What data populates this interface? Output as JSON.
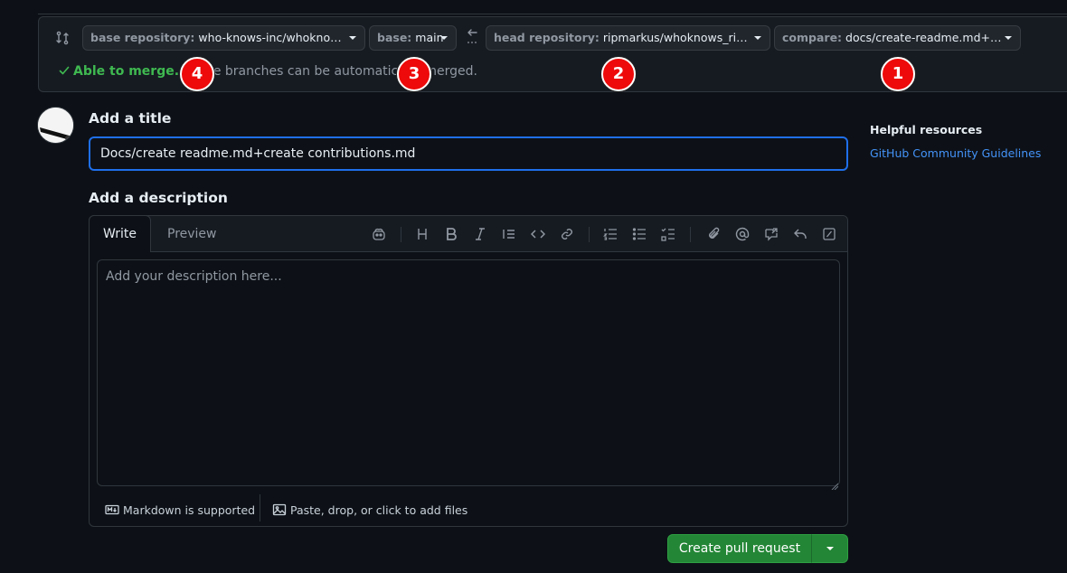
{
  "compare": {
    "base_repo_key": "base repository:",
    "base_repo_value": "who-knows-inc/whoknows_va...",
    "base_branch_key": "base:",
    "base_branch_value": "main",
    "head_repo_key": "head repository:",
    "head_repo_value": "ripmarkus/whoknows_ripmar...",
    "compare_key": "compare:",
    "compare_value": "docs/create-readme.md+creat...",
    "merge_status": "Able to merge.",
    "merge_message": "These branches can be automatically merged."
  },
  "markers": [
    "1",
    "2",
    "3",
    "4"
  ],
  "form": {
    "title_heading": "Add a title",
    "title_value": "Docs/create readme.md+create contributions.md",
    "description_heading": "Add a description",
    "tab_write": "Write",
    "tab_preview": "Preview",
    "description_placeholder": "Add your description here...",
    "markdown_note": "Markdown is supported",
    "attach_note": "Paste, drop, or click to add files"
  },
  "sidebar": {
    "heading": "Helpful resources",
    "link": "GitHub Community Guidelines"
  },
  "actions": {
    "create_label": "Create pull request"
  },
  "icons": {
    "compare": "git-compare-icon",
    "arrow": "arrow-left-icon",
    "check": "check-icon"
  },
  "colors": {
    "accent": "#1f6feb",
    "success": "#3fb950",
    "button": "#238636",
    "marker": "#ee0a0a"
  }
}
